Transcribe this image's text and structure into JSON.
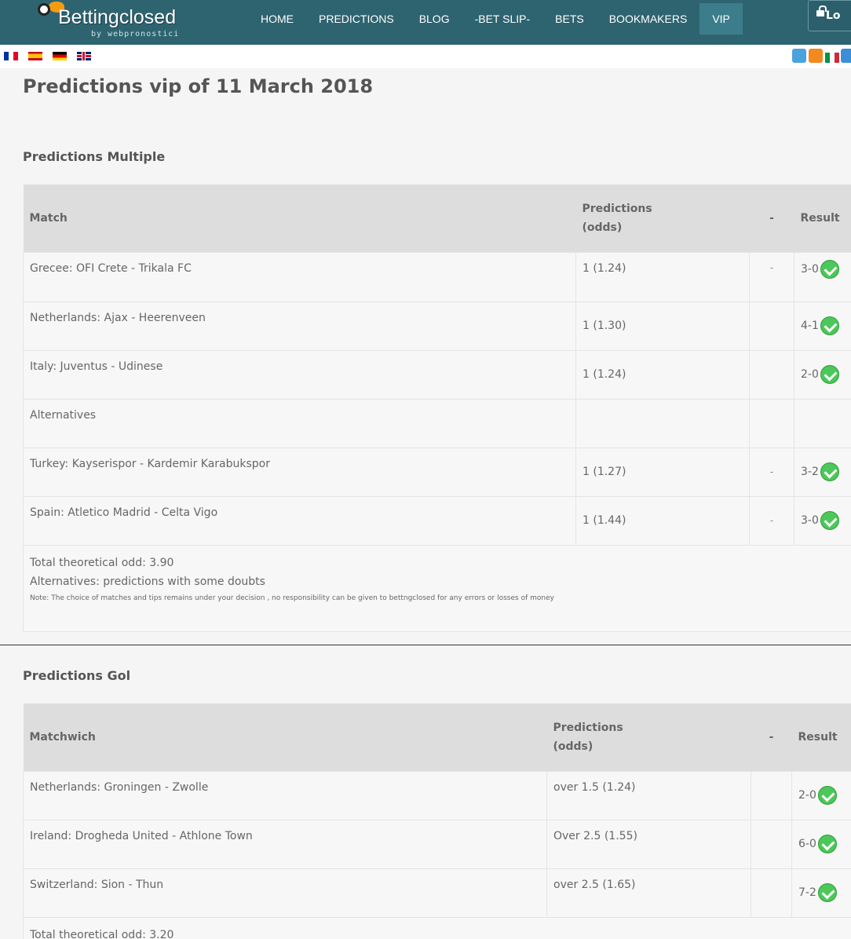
{
  "nav": {
    "brand": "Bettingclosed",
    "brand_sub": "by webpronostici",
    "items": [
      "HOME",
      "PREDICTIONS",
      "BLOG",
      "-BET SLIP-",
      "BETS",
      "BOOKMAKERS",
      "VIP"
    ],
    "active": "VIP",
    "login_label": "Lo"
  },
  "flags": [
    "fr-flag-icon",
    "es-flag-icon",
    "de-flag-icon",
    "gb-flag-icon"
  ],
  "social": [
    "twitter-icon",
    "rss-icon",
    "it-flag-icon",
    "twitter-icon"
  ],
  "page": {
    "title": "Predictions vip of 11 March 2018"
  },
  "multiple": {
    "title": "Predictions Multiple",
    "headers": {
      "match": "Match",
      "pred1": "Predictions",
      "pred2": "(odds)",
      "dash": "-",
      "result": "Result"
    },
    "rows": [
      {
        "match": "Grecee: OFI Crete - Trikala FC",
        "pred": "1 (1.24)",
        "dash": "-",
        "result": "3-0",
        "check": true
      },
      {
        "match": "Netherlands: Ajax - Heerenveen",
        "pred": "1 (1.30)",
        "dash": "",
        "result": "4-1",
        "check": true
      },
      {
        "match": "Italy: Juventus - Udinese",
        "pred": "1 (1.24)",
        "dash": "",
        "result": "2-0",
        "check": true
      },
      {
        "match": "Alternatives",
        "pred": "",
        "dash": "",
        "result": "",
        "check": false
      },
      {
        "match": "Turkey: Kayserispor - Kardemir Karabukspor",
        "pred": "1 (1.27)",
        "dash": "-",
        "result": "3-2",
        "check": true
      },
      {
        "match": "Spain: Atletico Madrid - Celta Vigo",
        "pred": "1 (1.44)",
        "dash": "-",
        "result": "3-0",
        "check": true
      }
    ],
    "total": "Total theoretical odd: 3.90",
    "alternatives_note": "Alternatives: predictions with some doubts",
    "note": "Note:  The choice of matches and tips remains under your decision , no responsibility can be given to bettngclosed for any errors or losses of money"
  },
  "gol": {
    "title": "Predictions Gol",
    "headers": {
      "match": "Matchwich",
      "pred1": "Predictions",
      "pred2": "(odds)",
      "dash": "-",
      "result": "Result"
    },
    "rows": [
      {
        "match": "Netherlands: Groningen - Zwolle",
        "pred": "over 1.5 (1.24)",
        "result": "2-0",
        "check": true
      },
      {
        "match": "Ireland: Drogheda United - Athlone Town",
        "pred": "Over 2.5 (1.55)",
        "result": "6-0",
        "check": true
      },
      {
        "match": "Switzerland: Sion - Thun",
        "pred": "over 2.5 (1.65)",
        "result": "7-2",
        "check": true
      }
    ],
    "total": "Total theoretical odd: 3.20"
  },
  "colors": {
    "topbar": "#2e6470",
    "active_tab": "#3c7d8c",
    "header_row": "#dddddd",
    "check": "#4cc75a"
  }
}
